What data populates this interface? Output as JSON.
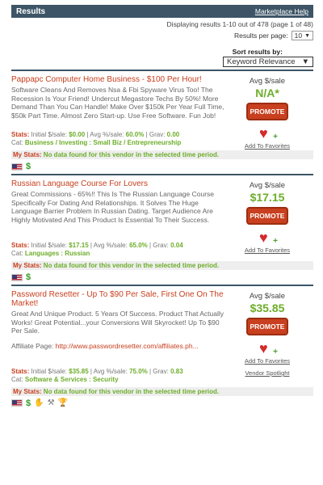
{
  "header": {
    "title": "Results",
    "help_link": "Marketplace Help"
  },
  "meta": {
    "displaying": "Displaying results 1-10 out of 478 (page 1 of 48)"
  },
  "per_page": {
    "label": "Results per page:",
    "value": "10"
  },
  "sort": {
    "label": "Sort results by:",
    "value": "Keyword Relevance"
  },
  "common": {
    "avg_label": "Avg $/sale",
    "promote": "PROMOTE",
    "favorites": "Add To Favorites",
    "stats_label": "Stats:",
    "mystats_label": "My Stats:",
    "mystats_text": "No data found for this vendor in the selected time period.",
    "cat_label": "Cat:"
  },
  "results": [
    {
      "title": "Pappapc Computer Home Business - $100 Per Hour!",
      "desc": "Software Cleans And Removes Nsa & Fbi Spyware Virus Too! The Recession Is Your Friend! Undercut Megastore Techs By 50%! More Demand Than You Can Handle! Make Over $150k Per Year Full Time, $50k Part Time. Almost Zero Start-up. Use Free Software. Fun Job!",
      "avg": "N/A*",
      "stats": {
        "initial_label": "Initial $/sale:",
        "initial": "$0.00",
        "pct_label": "Avg %/sale:",
        "pct": "60.0%",
        "grav_label": "Grav:",
        "grav": "0.00"
      },
      "cat": "Business / Investing : Small Biz / Entrepreneurship"
    },
    {
      "title": "Russian Language Course For Lovers",
      "desc": "Great Commissions - 65%!! This Is The Russian Language Course Specifically For Dating And Relationships. It Solves The Huge Language Barrier Problem In Russian Dating. Target Audience Are Highly Motivated And This Product Is Essential To Their Success.",
      "avg": "$17.15",
      "stats": {
        "initial_label": "Initial $/sale:",
        "initial": "$17.15",
        "pct_label": "Avg %/sale:",
        "pct": "65.0%",
        "grav_label": "Grav:",
        "grav": "0.04"
      },
      "cat": "Languages : Russian"
    },
    {
      "title": "Password Resetter - Up To $90 Per Sale, First One On The Market!",
      "desc": "Great And Unique Product. 5 Years Of Success. Product That Actually Works! Great Potential...your Conversions Will Skyrocket! Up To $90 Per Sale.",
      "aff_label": "Affiliate Page:",
      "aff_url": "http://www.passwordresetter.com/affiliates.ph...",
      "avg": "$35.85",
      "spotlight": "Vendor Spotlight",
      "stats": {
        "initial_label": "Initial $/sale:",
        "initial": "$35.85",
        "pct_label": "Avg %/sale:",
        "pct": "75.0%",
        "grav_label": "Grav:",
        "grav": "0.83"
      },
      "cat": "Software & Services : Security"
    }
  ],
  "colors": {
    "header_bg": "#3d5566",
    "accent_red": "#c8401f",
    "accent_green": "#6dad2a"
  },
  "icons": [
    "flag-us-icon",
    "dollar-icon",
    "heart-plus-icon",
    "spotlight-icon",
    "trophy-icon",
    "tools-icon"
  ]
}
